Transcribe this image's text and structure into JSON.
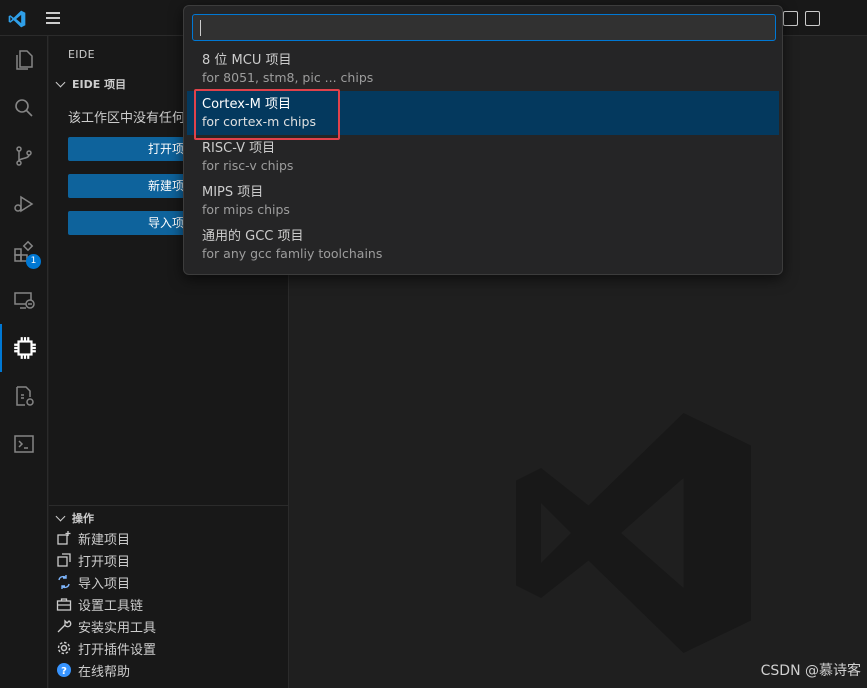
{
  "sidebar": {
    "title": "EIDE",
    "projects_section": "EIDE 项目",
    "empty_message": "该工作区中没有任何",
    "buttons": [
      "打开项目",
      "新建项目",
      "导入项目"
    ],
    "ops_section": "操作",
    "ops": [
      {
        "label": "新建项目",
        "icon": "new-project-icon"
      },
      {
        "label": "打开项目",
        "icon": "open-project-icon"
      },
      {
        "label": "导入项目",
        "icon": "import-project-icon"
      },
      {
        "label": "设置工具链",
        "icon": "toolbox-icon"
      },
      {
        "label": "安装实用工具",
        "icon": "install-tools-icon"
      },
      {
        "label": "打开插件设置",
        "icon": "gear-icon"
      },
      {
        "label": "在线帮助",
        "icon": "help-icon"
      }
    ]
  },
  "activity_bar": {
    "extensions_badge": "1"
  },
  "quick_pick": {
    "input_value": "",
    "items": [
      {
        "label": "8 位 MCU 项目",
        "description": "for 8051, stm8, pic ... chips"
      },
      {
        "label": "Cortex-M 项目",
        "description": "for cortex-m chips"
      },
      {
        "label": "RISC-V 项目",
        "description": "for risc-v chips"
      },
      {
        "label": "MIPS 项目",
        "description": "for mips chips"
      },
      {
        "label": "通用的 GCC 项目",
        "description": "for any gcc famliy toolchains"
      }
    ],
    "selected_index": 1
  },
  "watermark": "CSDN @慕诗客",
  "colors": {
    "accent": "#0078d4",
    "selection": "#04395e",
    "button": "#0e639c",
    "highlight_box": "#e0424b"
  }
}
